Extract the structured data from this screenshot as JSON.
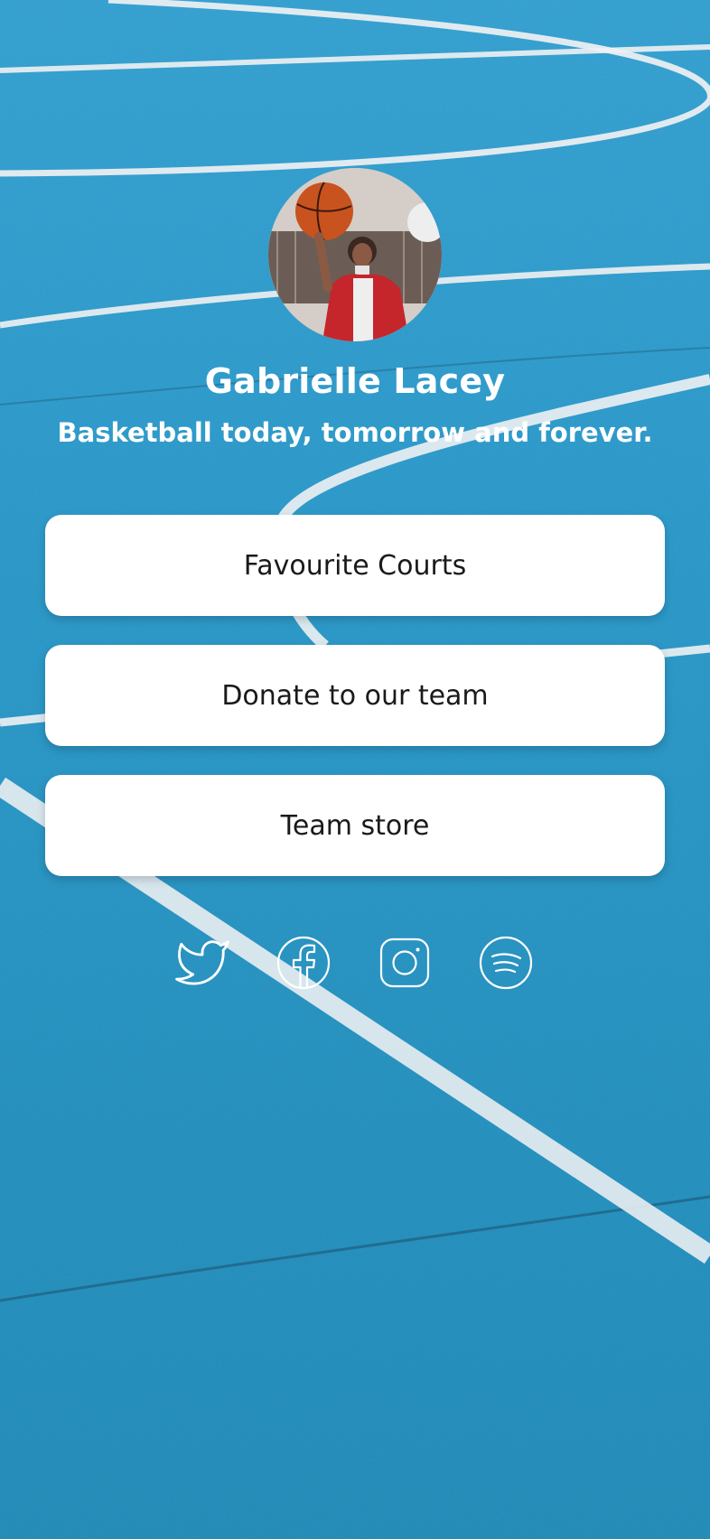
{
  "profile": {
    "name": "Gabrielle Lacey",
    "bio": "Basketball today, tomorrow and forever."
  },
  "links": [
    {
      "label": "Favourite Courts"
    },
    {
      "label": "Donate to our team"
    },
    {
      "label": "Team store"
    }
  ],
  "socials": [
    {
      "icon": "twitter-icon"
    },
    {
      "icon": "facebook-icon"
    },
    {
      "icon": "instagram-icon"
    },
    {
      "icon": "spotify-icon"
    }
  ],
  "colors": {
    "court": "#2597c9",
    "button_bg": "#ffffff",
    "button_text": "#1a1a1a",
    "text": "#ffffff"
  }
}
